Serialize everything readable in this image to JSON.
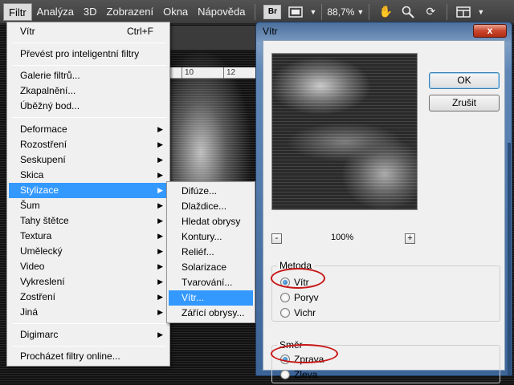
{
  "menubar": {
    "items": [
      "Filtr",
      "Analýza",
      "3D",
      "Zobrazení",
      "Okna",
      "Nápověda"
    ],
    "bridge_label": "Br",
    "zoom": "88,7%"
  },
  "filter_menu": {
    "last_filter": "Vítr",
    "last_filter_shortcut": "Ctrl+F",
    "smart": "Převést pro inteligentní filtry",
    "gallery": "Galerie filtrů...",
    "liquify": "Zkapalnění...",
    "vanishing": "Úběžný bod...",
    "categories": [
      "Deformace",
      "Rozostření",
      "Seskupení",
      "Skica",
      "Stylizace",
      "Šum",
      "Tahy štětce",
      "Textura",
      "Umělecký",
      "Video",
      "Vykreslení",
      "Zostření",
      "Jiná"
    ],
    "digimarc": "Digimarc",
    "browse": "Procházet filtry online..."
  },
  "submenu": {
    "items": [
      "Difúze...",
      "Dlaždice...",
      "Hledat obrysy",
      "Kontury...",
      "Reliéf...",
      "Solarizace",
      "Tvarování...",
      "Vítr...",
      "Zářící obrysy..."
    ]
  },
  "ruler": {
    "labels": [
      "10",
      "12"
    ]
  },
  "dialog": {
    "title": "Vítr",
    "close": "x",
    "ok": "OK",
    "cancel": "Zrušit",
    "zoom_minus": "-",
    "zoom_plus": "+",
    "zoom_value": "100%",
    "method_label": "Metoda",
    "method_options": [
      "Vítr",
      "Poryv",
      "Vichr"
    ],
    "direction_label": "Směr",
    "direction_options": [
      "Zprava",
      "Zleva"
    ]
  },
  "colors": {
    "menu_highlight": "#3399ff",
    "annotation_red": "#c81616",
    "dialog_frame": "#5f87b6"
  }
}
